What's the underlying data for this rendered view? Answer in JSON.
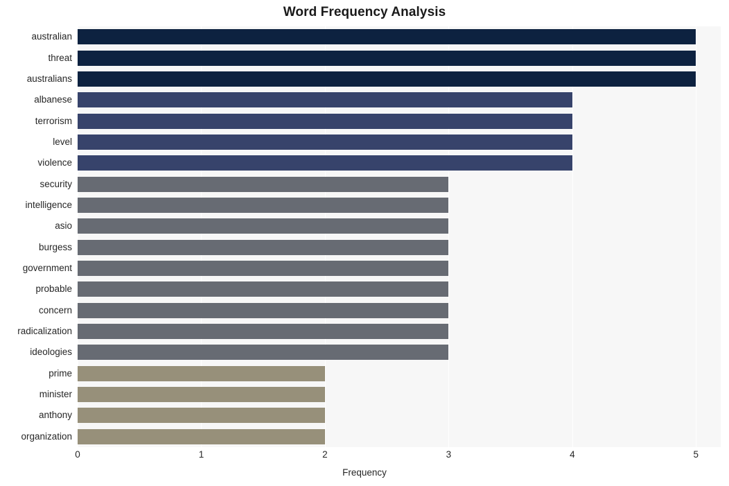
{
  "chart_data": {
    "type": "bar",
    "orientation": "horizontal",
    "title": "Word Frequency Analysis",
    "xlabel": "Frequency",
    "ylabel": "",
    "xlim": [
      0,
      5.2
    ],
    "xticks": [
      "0",
      "1",
      "2",
      "3",
      "4",
      "5"
    ],
    "xtick_values": [
      0,
      1,
      2,
      3,
      4,
      5
    ],
    "grid": true,
    "grid_axis": "x",
    "legend": "none",
    "categories": [
      "australian",
      "threat",
      "australians",
      "albanese",
      "terrorism",
      "level",
      "violence",
      "security",
      "intelligence",
      "asio",
      "burgess",
      "government",
      "probable",
      "concern",
      "radicalization",
      "ideologies",
      "prime",
      "minister",
      "anthony",
      "organization"
    ],
    "values": [
      5,
      5,
      5,
      4,
      4,
      4,
      4,
      3,
      3,
      3,
      3,
      3,
      3,
      3,
      3,
      3,
      2,
      2,
      2,
      2
    ],
    "bar_colors": [
      "#0d2240",
      "#0d2240",
      "#0d2240",
      "#37436b",
      "#37436b",
      "#37436b",
      "#37436b",
      "#676b73",
      "#676b73",
      "#676b73",
      "#676b73",
      "#676b73",
      "#676b73",
      "#676b73",
      "#676b73",
      "#676b73",
      "#97907a",
      "#97907a",
      "#97907a",
      "#97907a"
    ]
  },
  "style": {
    "plot_background": "#f7f7f7",
    "figure_background": "#ffffff",
    "gridline_color": "#ffffff",
    "text_color": "#262626",
    "title_color": "#1a1a1a"
  }
}
